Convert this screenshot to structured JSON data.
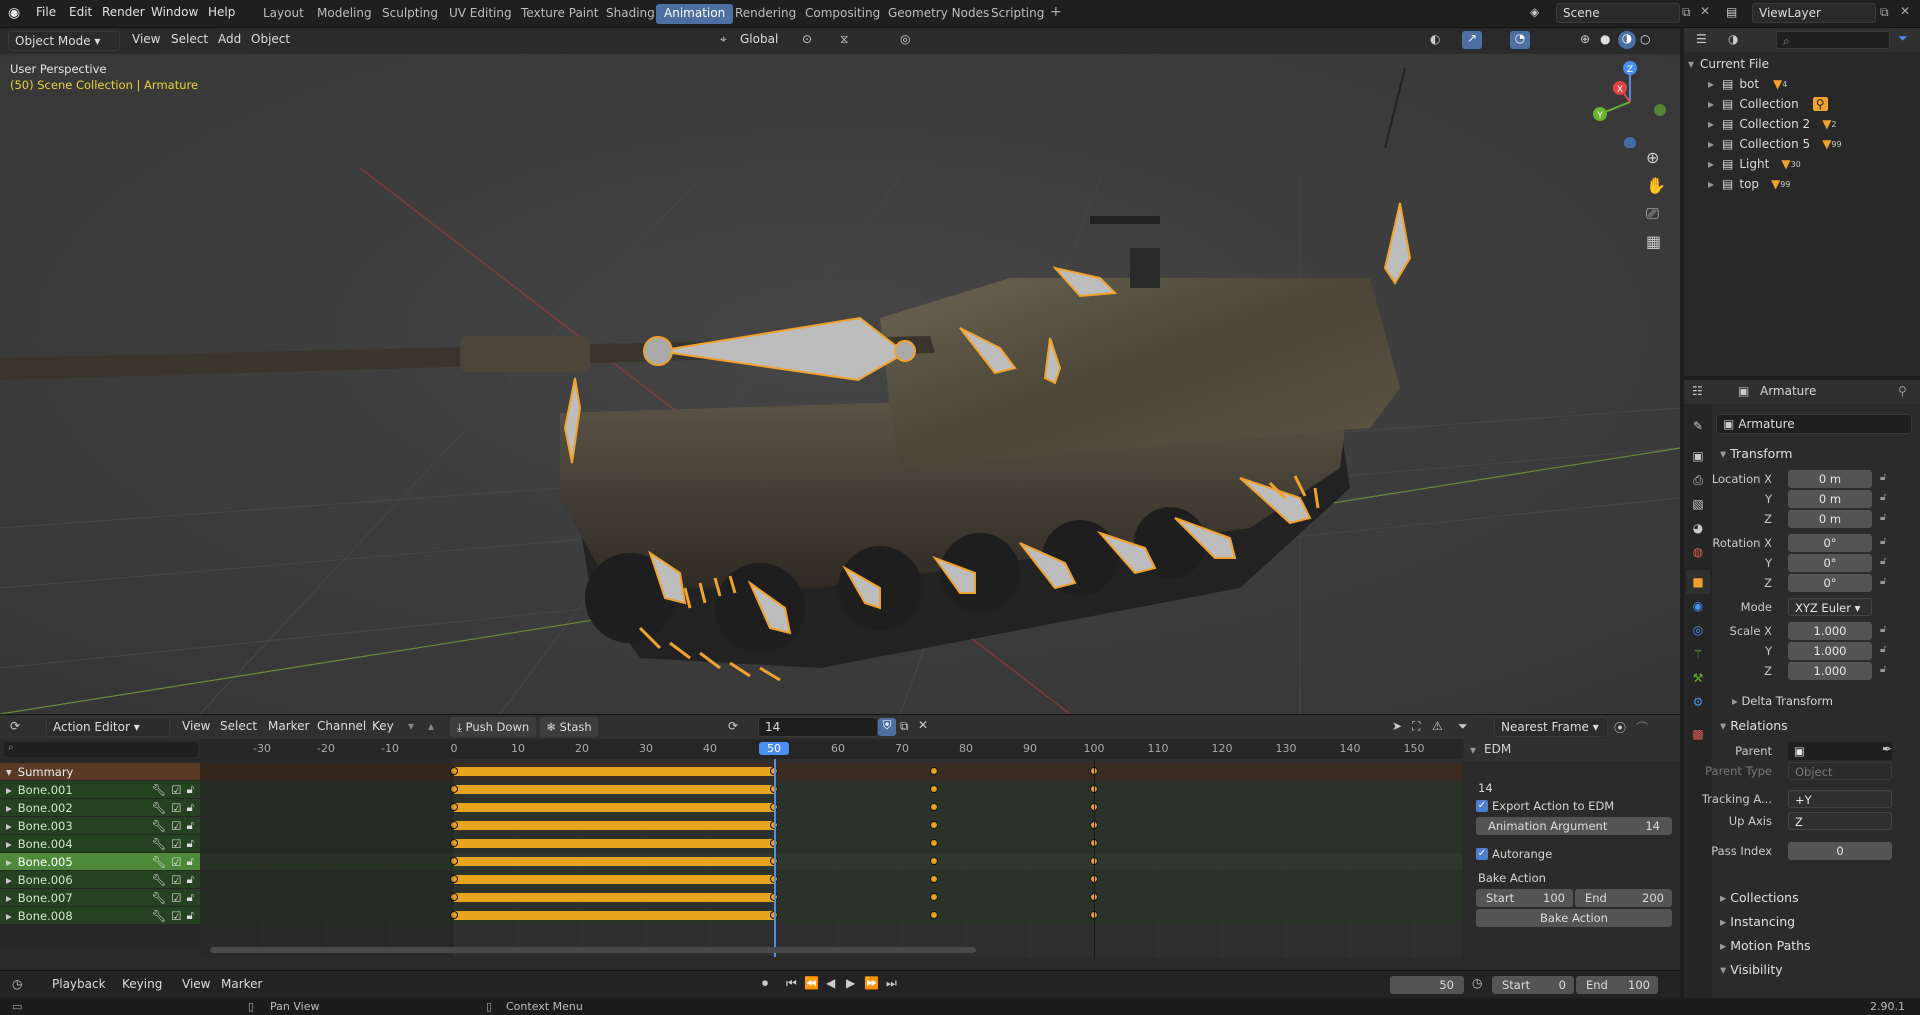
{
  "topbar": {
    "menus": [
      "File",
      "Edit",
      "Render",
      "Window",
      "Help"
    ],
    "workspaces": [
      "Layout",
      "Modeling",
      "Sculpting",
      "UV Editing",
      "Texture Paint",
      "Shading",
      "Animation",
      "Rendering",
      "Compositing",
      "Geometry Nodes",
      "Scripting"
    ],
    "active_workspace": "Animation",
    "scene": "Scene",
    "view_layer": "ViewLayer"
  },
  "viewport": {
    "mode": "Object Mode",
    "menus": [
      "View",
      "Select",
      "Add",
      "Object"
    ],
    "transform_orientation": "Global",
    "perspective_label": "User Perspective",
    "collection_label": "(50) Scene Collection | Armature",
    "gizmo_axes": [
      "X",
      "Y",
      "Z"
    ]
  },
  "outliner": {
    "root": "Current File",
    "items": [
      {
        "name": "bot",
        "badge": "4"
      },
      {
        "name": "Collection",
        "badge": ""
      },
      {
        "name": "Collection 2",
        "badge": "2"
      },
      {
        "name": "Collection 5",
        "badge": "99"
      },
      {
        "name": "Light",
        "badge": "30"
      },
      {
        "name": "top",
        "badge": "99"
      }
    ]
  },
  "properties": {
    "object_name": "Armature",
    "data_name": "Armature",
    "transform_title": "Transform",
    "location": {
      "label": "Location X",
      "x": "0 m",
      "y": "0 m",
      "z": "0 m"
    },
    "rotation": {
      "label": "Rotation X",
      "x": "0°",
      "y": "0°",
      "z": "0°"
    },
    "mode_label": "Mode",
    "mode_value": "XYZ Euler",
    "scale": {
      "label": "Scale X",
      "x": "1.000",
      "y": "1.000",
      "z": "1.000"
    },
    "axis_y": "Y",
    "axis_z": "Z",
    "delta_transform": "Delta Transform",
    "relations_title": "Relations",
    "parent_label": "Parent",
    "parent_type_label": "Parent Type",
    "parent_type_value": "Object",
    "tracking_label": "Tracking A...",
    "tracking_value": "+Y",
    "up_axis_label": "Up Axis",
    "up_axis_value": "Z",
    "pass_index_label": "Pass Index",
    "pass_index_value": "0",
    "collapsed_sections": [
      "Collections",
      "Instancing",
      "Motion Paths"
    ],
    "visibility": "Visibility"
  },
  "dopesheet": {
    "editor": "Action Editor",
    "menus": [
      "View",
      "Select",
      "Marker",
      "Channel",
      "Key"
    ],
    "push_down": "Push Down",
    "stash": "Stash",
    "action_name": "14",
    "snap": "Nearest Frame",
    "ruler_labels": [
      "-30",
      "-20",
      "-10",
      "0",
      "10",
      "20",
      "30",
      "40",
      "50",
      "60",
      "70",
      "80",
      "90",
      "100",
      "110",
      "120",
      "130",
      "140",
      "150"
    ],
    "current_frame_marker": "50",
    "summary": "Summary",
    "channels": [
      "Bone.001",
      "Bone.002",
      "Bone.003",
      "Bone.004",
      "Bone.005",
      "Bone.006",
      "Bone.007",
      "Bone.008"
    ],
    "selected_channel": "Bone.005",
    "keyframes": [
      0,
      50,
      75,
      100
    ]
  },
  "edm": {
    "title": "EDM",
    "action_label": "14",
    "export_label": "Export Action to EDM",
    "anim_arg_label": "Animation Argument",
    "anim_arg_value": "14",
    "autorange_label": "Autorange",
    "bake_title": "Bake Action",
    "start_label": "Start",
    "start_value": "100",
    "end_label": "End",
    "end_value": "200",
    "bake_button": "Bake Action"
  },
  "playback": {
    "menus": [
      "Playback",
      "Keying",
      "View",
      "Marker"
    ],
    "current_frame": "50",
    "start_label": "Start",
    "start_value": "0",
    "end_label": "End",
    "end_value": "100"
  },
  "status": {
    "pan": "Pan View",
    "context": "Context Menu",
    "version": "2.90.1"
  },
  "colors": {
    "accent": "#4d6fa1",
    "keyframe": "#e8a31f",
    "playhead": "#4b8ff0",
    "selected_bone": "#f0a22f"
  }
}
